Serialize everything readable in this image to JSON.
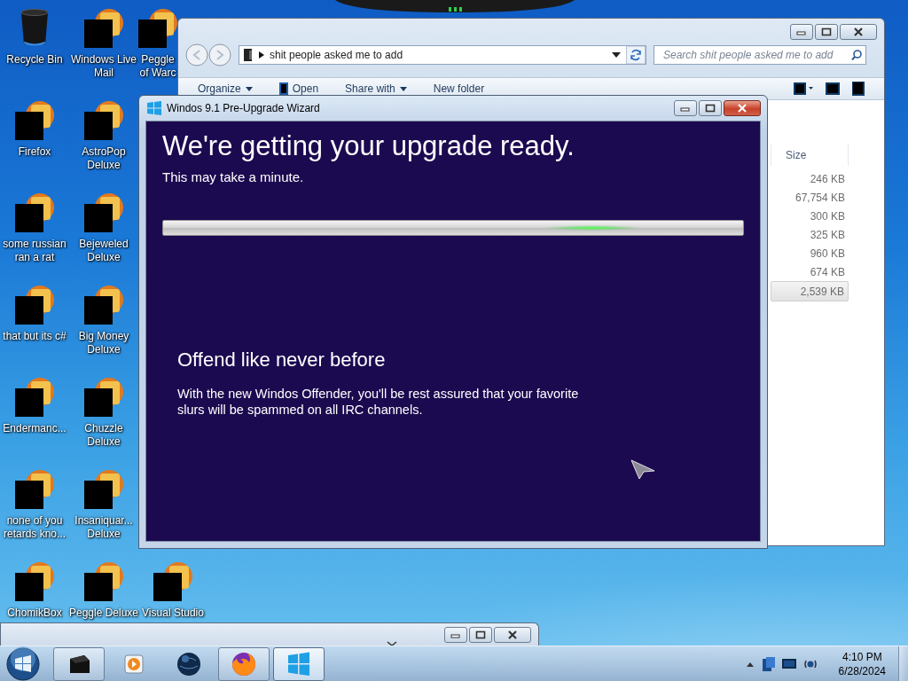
{
  "desktop_icons": [
    {
      "kind": "bin",
      "label": [
        "Recycle Bin"
      ]
    },
    {
      "kind": "covered",
      "label": [
        "Firefox"
      ]
    },
    {
      "kind": "covered",
      "label": [
        "some russian",
        "ran a rat"
      ]
    },
    {
      "kind": "covered",
      "label": [
        "that but its c#"
      ]
    },
    {
      "kind": "covered",
      "label": [
        "Endermanc..."
      ]
    },
    {
      "kind": "covered",
      "label": [
        "none of you",
        "retards kno..."
      ]
    },
    {
      "kind": "covered",
      "label": [
        "ChomikBox"
      ]
    },
    {
      "kind": "covered",
      "label": [
        "Windows Live",
        "Mail"
      ]
    },
    {
      "kind": "covered",
      "label": [
        "AstroPop",
        "Deluxe"
      ]
    },
    {
      "kind": "covered",
      "label": [
        "Bejeweled",
        "Deluxe"
      ]
    },
    {
      "kind": "covered",
      "label": [
        "Big Money",
        "Deluxe"
      ]
    },
    {
      "kind": "covered",
      "label": [
        "Chuzzle",
        "Deluxe"
      ]
    },
    {
      "kind": "covered",
      "label": [
        "Insaniquar...",
        "Deluxe"
      ]
    },
    {
      "kind": "covered",
      "label": [
        "Peggle Deluxe"
      ]
    },
    {
      "kind": "covered",
      "label": [
        "Peggle",
        "of Warc"
      ]
    },
    {
      "kind": "covered",
      "label": [
        "Visual Studio"
      ]
    }
  ],
  "explorer": {
    "address": "shit people asked me to add",
    "search_placeholder": "Search shit people asked me to add",
    "toolbar": [
      {
        "label": "Organize",
        "dropdown": true
      },
      {
        "label": "Open",
        "dropdown": false
      },
      {
        "label": "Share with",
        "dropdown": true
      },
      {
        "label": "New folder",
        "dropdown": false
      }
    ],
    "column": "Size",
    "rows": [
      {
        "size": "246 KB",
        "selected": false
      },
      {
        "size": "67,754 KB",
        "selected": false
      },
      {
        "size": "300 KB",
        "selected": false
      },
      {
        "size": "325 KB",
        "selected": false
      },
      {
        "size": "960 KB",
        "selected": false
      },
      {
        "size": "674 KB",
        "selected": false
      },
      {
        "size": "2,539 KB",
        "selected": true
      }
    ]
  },
  "wizard": {
    "title": "Windos 9.1 Pre-Upgrade Wizard",
    "heading": "We're getting your upgrade ready.",
    "subtitle": "This may take a minute.",
    "progress": {
      "level": 0.74
    },
    "feature_title": "Offend like never before",
    "feature_text": "With the new Windos Offender, you'll be rest assured that your favorite slurs will be spammed on all IRC channels."
  },
  "taskbar": {
    "items": [
      {
        "kind": "blackbox",
        "open": true,
        "selected": false
      },
      {
        "kind": "media",
        "open": false,
        "selected": false
      },
      {
        "kind": "globe",
        "open": false,
        "selected": false
      },
      {
        "kind": "firefox",
        "open": true,
        "selected": false
      },
      {
        "kind": "windows",
        "open": true,
        "selected": true
      }
    ],
    "time": "4:10 PM",
    "date": "6/28/2024"
  }
}
